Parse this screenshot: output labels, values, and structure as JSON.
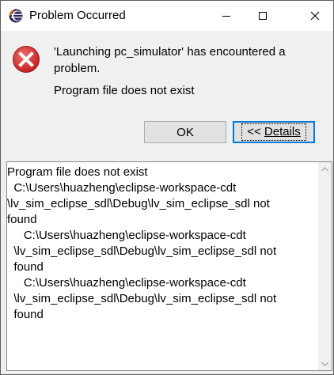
{
  "window": {
    "title": "Problem Occurred"
  },
  "message": {
    "main": "'Launching pc_simulator' has encountered a problem.",
    "sub": "Program file does not exist"
  },
  "buttons": {
    "ok_label": "OK",
    "details_prefix": "<< ",
    "details_label": "Details"
  },
  "details_text": {
    "lines": [
      "Program file does not exist",
      "  C:\\Users\\huazheng\\eclipse-workspace-cdt",
      "\\lv_sim_eclipse_sdl\\Debug\\lv_sim_eclipse_sdl not",
      "found",
      "     C:\\Users\\huazheng\\eclipse-workspace-cdt",
      "  \\lv_sim_eclipse_sdl\\Debug\\lv_sim_eclipse_sdl not",
      "  found",
      "     C:\\Users\\huazheng\\eclipse-workspace-cdt",
      "  \\lv_sim_eclipse_sdl\\Debug\\lv_sim_eclipse_sdl not",
      "  found"
    ]
  },
  "icons": {
    "app": "eclipse-icon",
    "error": "error-icon",
    "minimize": "minimize-icon",
    "maximize": "maximize-icon",
    "close": "close-icon",
    "scroll_up": "chevron-up-icon",
    "scroll_down": "chevron-down-icon"
  },
  "colors": {
    "error_red": "#d32f2f",
    "focus_blue": "#0078d7",
    "eclipse_purple": "#2c2255"
  }
}
